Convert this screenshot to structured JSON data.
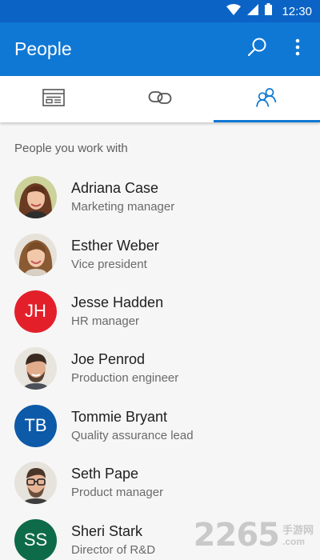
{
  "status_bar": {
    "time": "12:30",
    "icons": [
      "wifi-icon",
      "cellular-signal-icon",
      "battery-icon"
    ]
  },
  "app_bar": {
    "title": "People",
    "actions": [
      "search-icon",
      "more-vert-icon"
    ],
    "color": "#0f78d4"
  },
  "tabs": [
    {
      "icon": "inbox-icon",
      "active": false
    },
    {
      "icon": "link-icon",
      "active": false
    },
    {
      "icon": "people-icon",
      "active": true
    }
  ],
  "section": {
    "title": "People you work with"
  },
  "people": [
    {
      "name": "Adriana Case",
      "title": "Marketing manager",
      "avatar": "photo"
    },
    {
      "name": "Esther Weber",
      "title": "Vice president",
      "avatar": "photo"
    },
    {
      "name": "Jesse Hadden",
      "title": "HR manager",
      "avatar": "initials",
      "initials": "JH",
      "color": "#e3202a"
    },
    {
      "name": "Joe Penrod",
      "title": "Production engineer",
      "avatar": "photo"
    },
    {
      "name": "Tommie Bryant",
      "title": "Quality assurance lead",
      "avatar": "initials",
      "initials": "TB",
      "color": "#0d5aa8"
    },
    {
      "name": "Seth Pape",
      "title": "Product manager",
      "avatar": "photo"
    },
    {
      "name": "Sheri Stark",
      "title": "Director of R&D",
      "avatar": "initials",
      "initials": "SS",
      "color": "#0e6b4a"
    }
  ],
  "watermark": {
    "number": "2265",
    "chinese": "手游网",
    "suffix": ".com"
  }
}
